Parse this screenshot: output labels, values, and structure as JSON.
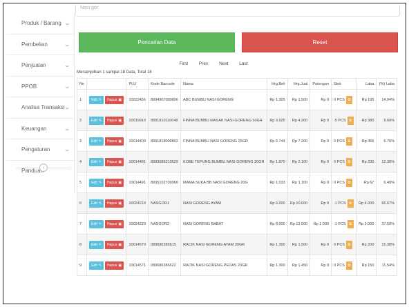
{
  "top_input": {
    "value": "Nasi gor"
  },
  "sidebar": {
    "items": [
      {
        "label": "Produk / Barang",
        "chevron": "⌄"
      },
      {
        "label": "Pembelian",
        "chevron": "⌄"
      },
      {
        "label": "Penjualan",
        "chevron": "⌄"
      },
      {
        "label": "PPOB",
        "chevron": "⌄"
      },
      {
        "label": "Analisa Transaksi",
        "chevron": "⌄"
      },
      {
        "label": "Keuangan",
        "chevron": "⌄"
      },
      {
        "label": "Pengaturan",
        "chevron": "⌄"
      },
      {
        "label": "Panduan",
        "chevron": ""
      }
    ],
    "toggle_icon": "‹"
  },
  "buttons": {
    "search": "Pencarian Data",
    "reset": "Reset"
  },
  "pager": {
    "first": "First",
    "prev": "Prev",
    "next": "Next",
    "last": "Last"
  },
  "info": "Menampilkan 1 sampai 18 Data, Total 18",
  "table": {
    "headers": [
      "No",
      "",
      "PLU",
      "Kode Barcode",
      "Nama",
      "Hrg.Beli",
      "Hrg.Jual",
      "Potongan",
      "Stok",
      "Laba",
      "(%) Laba"
    ],
    "edit_label": "Edit",
    "delete_label": "Hapus",
    "rows": [
      {
        "no": "1",
        "plu": "10222456",
        "barcode": "8994907000806",
        "nama": "ABC BUMBU NASI GORENG",
        "beli": "Rp 1.305",
        "jual": "Rp 1.500",
        "potongan": "Rp 0",
        "stok": "0 PCS",
        "laba": "Rp 195",
        "persen": "14.94%"
      },
      {
        "no": "2",
        "plu": "10019919",
        "barcode": "8991810110048",
        "nama": "FINNA BUMBU MASAK NASI GORENG 50GR",
        "beli": "Rp 3.920",
        "jual": "Rp 4.300",
        "potongan": "Rp 0",
        "stok": "-5 PCS",
        "laba": "Rp 380",
        "persen": "9.69%"
      },
      {
        "no": "3",
        "plu": "10014400",
        "barcode": "8991818000802",
        "nama": "FINNA BUMBU NASI GORENG 25GR",
        "beli": "Rp 6.744",
        "jual": "Rp 7.200",
        "potongan": "Rp 0",
        "stok": "0 PCS",
        "laba": "Rp 456",
        "persen": "6.76%"
      },
      {
        "no": "4",
        "plu": "10014481",
        "barcode": "8993089210529",
        "nama": "KOBE TEPUNG BUMBU NASI GORENG 20GR",
        "beli": "Rp 1.870",
        "jual": "Rp 2.100",
        "potongan": "Rp 0",
        "stok": "0 PCS",
        "laba": "Rp 230",
        "persen": "12.30%"
      },
      {
        "no": "5",
        "plu": "10014491",
        "barcode": "8995102700060",
        "nama": "MAMA SUKA BB NASI GORENG 20G",
        "beli": "Rp 1.033",
        "jual": "Rp 1.100",
        "potongan": "Rp 0",
        "stok": "0 PCS",
        "laba": "Rp 67",
        "persen": "6.49%"
      },
      {
        "no": "6",
        "plu": "10024219",
        "barcode": "NASGOR1",
        "nama": "NASI GORENG AYAM",
        "beli": "Rp 6.000",
        "jual": "Rp 10.000",
        "potongan": "Rp 0",
        "stok": "-1 PCS",
        "laba": "Rp 4.000",
        "persen": "66.67%"
      },
      {
        "no": "7",
        "plu": "10024220",
        "barcode": "NASGOR2",
        "nama": "NASI GORENG BABAT",
        "beli": "Rp 8.000",
        "jual": "Rp 12.000",
        "potongan": "Rp 1.000",
        "stok": "-1 PCS",
        "laba": "Rp 3.000",
        "persen": "37.50%"
      },
      {
        "no": "8",
        "plu": "10014570",
        "barcode": "089686386615",
        "nama": "RACIK NASI GORENG AYAM 20GR",
        "beli": "Rp 1.300",
        "jual": "Rp 1.500",
        "potongan": "Rp 0",
        "stok": "0 PCS",
        "laba": "Rp 200",
        "persen": "15.38%"
      },
      {
        "no": "9",
        "plu": "10014571",
        "barcode": "089686386622",
        "nama": "RACIK NASI GORENG PEDAS 20GR",
        "beli": "Rp 1.300",
        "jual": "Rp 1.450",
        "potongan": "Rp 0",
        "stok": "0 PCS",
        "laba": "Rp 150",
        "persen": "11.54%"
      }
    ]
  },
  "colors": {
    "green": "#5cb85c",
    "red": "#d9534f",
    "info": "#5bc0de",
    "warning": "#f0ad4e"
  },
  "icons": {
    "edit": "pencil-icon",
    "delete": "trash-icon",
    "stock": "edit-square-icon",
    "chevron": "chevron-down-icon",
    "toggle": "chevron-left-icon"
  }
}
